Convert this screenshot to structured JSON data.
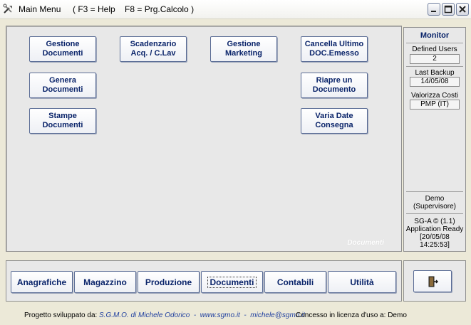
{
  "window": {
    "title": "Main Menu",
    "hint": "( F3 = Help    F8 = Prg.Calcolo )"
  },
  "main": {
    "buttons": [
      {
        "l1": "Gestione",
        "l2": "Documenti"
      },
      {
        "l1": "Scadenzario",
        "l2": "Acq. / C.Lav"
      },
      {
        "l1": "Gestione",
        "l2": "Marketing"
      },
      {
        "l1": "Cancella Ultimo",
        "l2": "DOC.Emesso"
      },
      {
        "l1": "Genera",
        "l2": "Documenti"
      },
      {
        "l1": "Riapre un",
        "l2": "Documento"
      },
      {
        "l1": "Stampe",
        "l2": "Documenti"
      },
      {
        "l1": "Varia Date",
        "l2": "Consegna"
      }
    ],
    "watermark": "Documenti"
  },
  "monitor": {
    "title": "Monitor",
    "defined_users_label": "Defined Users",
    "defined_users_value": "2",
    "last_backup_label": "Last Backup",
    "last_backup_value": "14/05/08",
    "valorizza_label": "Valorizza Costi",
    "valorizza_value": "PMP (IT)",
    "user_line1": "Demo",
    "user_line2": "(Supervisore)",
    "status_line1": "SG-A © (1.1)",
    "status_line2": "Application Ready",
    "status_line3": "[20/05/08",
    "status_line4": "14:25:53]"
  },
  "nav": {
    "tabs": [
      "Anagrafiche",
      "Magazzino",
      "Produzione",
      "Documenti",
      "Contabili",
      "Utilità"
    ],
    "active": "Documenti"
  },
  "footer": {
    "prefix": "Progetto sviluppato da:",
    "credit": "S.G.M.O. di Michele Odorico  -  www.sgmo.it  -  michele@sgmo.it",
    "license": "Concesso in licenza d'uso a: Demo"
  },
  "icons": {
    "app": "tools-icon",
    "exit": "exit-door-icon"
  }
}
